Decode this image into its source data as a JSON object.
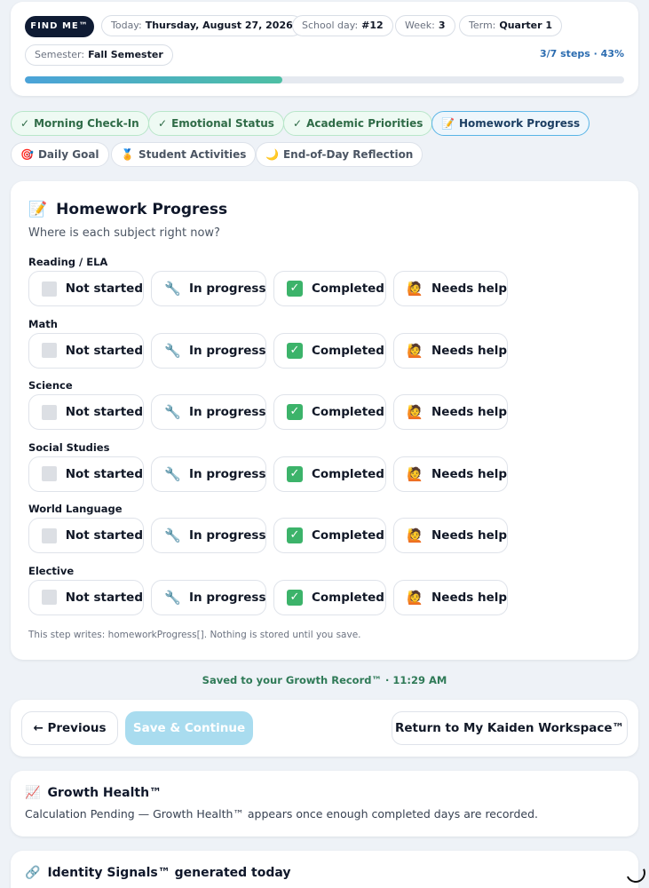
{
  "header": {
    "badge": "FIND ME™",
    "pills": [
      {
        "label": "Today:",
        "value": "Thursday, August 27, 2026"
      },
      {
        "label": "School day:",
        "value": "#12"
      },
      {
        "label": "Week:",
        "value": "3"
      },
      {
        "label": "Term:",
        "value": "Quarter 1"
      },
      {
        "label": "Semester:",
        "value": "Fall Semester"
      }
    ],
    "steps_text": "3/7 steps · 43%",
    "progress_fraction": 0.43
  },
  "steps": [
    {
      "icon": "✓",
      "label": "Morning Check-In",
      "state": "done"
    },
    {
      "icon": "✓",
      "label": "Emotional Status",
      "state": "done"
    },
    {
      "icon": "✓",
      "label": "Academic Priorities",
      "state": "done"
    },
    {
      "icon": "📝",
      "label": "Homework Progress",
      "state": "active"
    },
    {
      "icon": "🎯",
      "label": "Daily Goal",
      "state": "todo"
    },
    {
      "icon": "🏅",
      "label": "Student Activities",
      "state": "todo"
    },
    {
      "icon": "🌙",
      "label": "End-of-Day Reflection",
      "state": "todo"
    }
  ],
  "section": {
    "icon": "📝",
    "title": "Homework Progress",
    "subtitle": "Where is each subject right now?",
    "options": [
      {
        "key": "not_started",
        "label": "Not started"
      },
      {
        "key": "in_progress",
        "label": "In progress",
        "icon": "🔧"
      },
      {
        "key": "completed",
        "label": "Completed",
        "icon": "✓"
      },
      {
        "key": "needs_help",
        "label": "Needs help",
        "icon": "🙋"
      }
    ],
    "subjects": [
      "Reading / ELA",
      "Math",
      "Science",
      "Social Studies",
      "World Language",
      "Elective"
    ],
    "footnote": "This step writes: homeworkProgress[]. Nothing is stored until you save."
  },
  "saved_text": "Saved to your Growth Record™ · 11:29 AM",
  "nav": {
    "previous": "← Previous",
    "save": "Save & Continue",
    "return": "Return to My Kaiden Workspace™"
  },
  "growth_health": {
    "icon": "📈",
    "title": "Growth Health™",
    "text": "Calculation Pending — Growth Health™ appears once enough completed days are recorded."
  },
  "identity_signals": {
    "icon": "🔗",
    "title": "Identity Signals™ generated today"
  },
  "colors": {
    "badge_bg": "#0f1b33",
    "accent": "#2b6cb0",
    "done_chip": "#eefaf3",
    "active_border": "#58b4e6",
    "check_green": "#3cb36a",
    "saved_text": "#2f7a57",
    "save_button": "#a9dcef"
  }
}
